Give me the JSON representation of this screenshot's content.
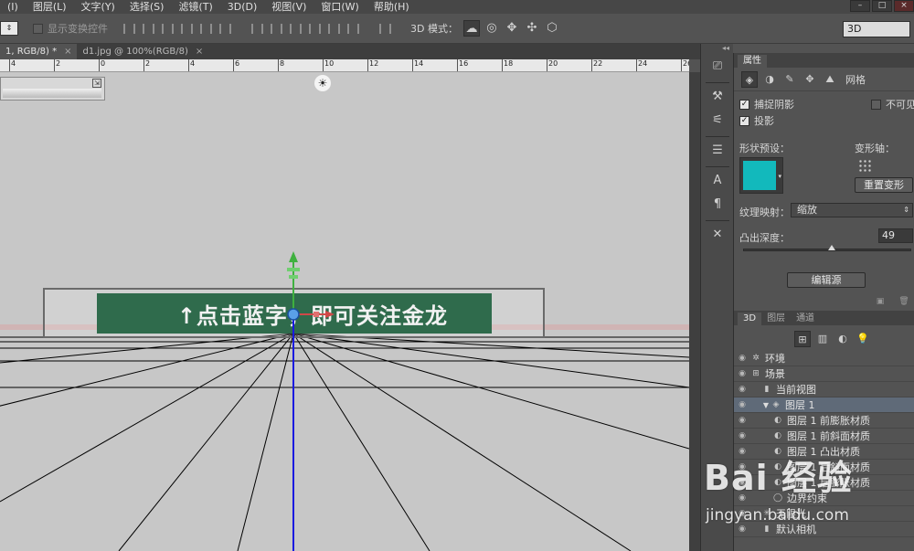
{
  "menu": [
    "(I)",
    "图层(L)",
    "文字(Y)",
    "选择(S)",
    "滤镜(T)",
    "3D(D)",
    "视图(V)",
    "窗口(W)",
    "帮助(H)"
  ],
  "options": {
    "show_transform_label": "显示变换控件",
    "mode_label": "3D 模式：",
    "workspace": "3D"
  },
  "tabs": [
    {
      "label": "1, RGB/8) *",
      "active": true
    },
    {
      "label": "d1.jpg @ 100%(RGB/8)",
      "active": false
    }
  ],
  "ruler_ticks": [
    "4",
    "2",
    "0",
    "2",
    "4",
    "6",
    "8",
    "10",
    "12",
    "14",
    "16",
    "18",
    "20",
    "22",
    "24",
    "26"
  ],
  "canvas": {
    "banner_text": "↑点击蓝字，即可关注金龙",
    "banner_color": "#2f6b4c"
  },
  "properties": {
    "tab": "属性",
    "mesh_label": "网格",
    "capture_shadows": "捕捉阴影",
    "invisible": "不可见",
    "cast_shadows": "投影",
    "shape_preset": "形状预设：",
    "deform_axis": "变形轴：",
    "reset_deform": "重置变形",
    "texture_map_label": "纹理映射：",
    "texture_map_value": "缩放",
    "extrude_depth_label": "凸出深度：",
    "extrude_depth_value": "49",
    "edit_source": "编辑源",
    "swatch_color": "#12b9bc"
  },
  "layers_panel": {
    "tabs": [
      "3D",
      "图层",
      "通道"
    ],
    "rows": [
      {
        "label": "环境",
        "indent": 0,
        "icon": "✲",
        "selected": false
      },
      {
        "label": "场景",
        "indent": 0,
        "icon": "⊞",
        "selected": false
      },
      {
        "label": "当前视图",
        "indent": 1,
        "icon": "▮",
        "selected": false
      },
      {
        "label": "图层 1",
        "indent": 1,
        "icon": "◈",
        "selected": true
      },
      {
        "label": "图层 1 前膨胀材质",
        "indent": 2,
        "icon": "◐",
        "selected": false
      },
      {
        "label": "图层 1 前斜面材质",
        "indent": 2,
        "icon": "◐",
        "selected": false
      },
      {
        "label": "图层 1 凸出材质",
        "indent": 2,
        "icon": "◐",
        "selected": false
      },
      {
        "label": "图层 1 后斜面材质",
        "indent": 2,
        "icon": "◐",
        "selected": false
      },
      {
        "label": "图层 1 后膨胀材质",
        "indent": 2,
        "icon": "◐",
        "selected": false
      },
      {
        "label": "边界约束",
        "indent": 2,
        "icon": "◯",
        "selected": false
      },
      {
        "label": "无限光",
        "indent": 1,
        "icon": "✳",
        "selected": false
      },
      {
        "label": "默认相机",
        "indent": 1,
        "icon": "▮",
        "selected": false
      }
    ]
  },
  "watermark": {
    "brand": "Bai 经验",
    "url": "jingyan.baidu.com"
  }
}
